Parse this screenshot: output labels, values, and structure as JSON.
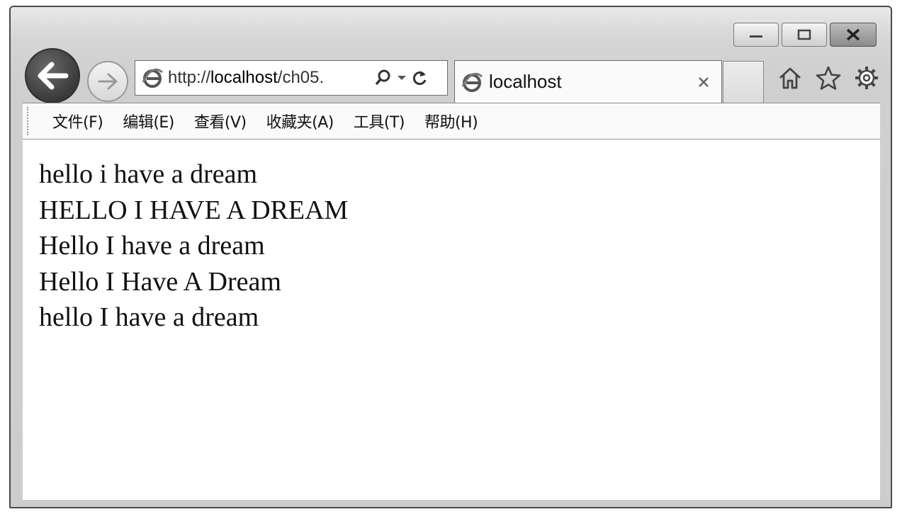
{
  "address_bar": {
    "url_prefix": "http://",
    "url_host": "localhost",
    "url_rest": "/ch05.",
    "search_icon": "search-icon",
    "dropdown_icon": "chevron-down-icon",
    "refresh_icon": "refresh-icon"
  },
  "tab": {
    "title": "localhost",
    "close_glyph": "×"
  },
  "window_controls": [
    "minimize-icon",
    "maximize-icon",
    "close-icon"
  ],
  "toolbar_icons": [
    "home-icon",
    "favorites-star-icon",
    "settings-gear-icon"
  ],
  "menu": {
    "items": [
      {
        "label": "文件(F)"
      },
      {
        "label": "编辑(E)"
      },
      {
        "label": "查看(V)"
      },
      {
        "label": "收藏夹(A)"
      },
      {
        "label": "工具(T)"
      },
      {
        "label": "帮助(H)"
      }
    ]
  },
  "content": {
    "lines": [
      "hello i have a dream",
      "HELLO I HAVE A DREAM",
      "Hello I have a dream",
      "Hello I Have A Dream",
      "hello I have a dream"
    ]
  },
  "colors": {
    "chrome": "#d0d0d0",
    "page_background": "#ffffff",
    "text": "#111111"
  }
}
